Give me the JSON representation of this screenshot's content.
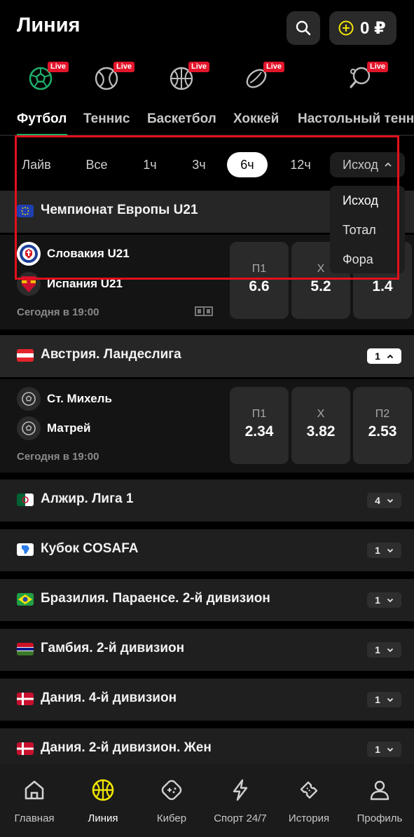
{
  "header": {
    "title": "Линия",
    "balance": "0 ₽"
  },
  "sports": [
    {
      "name": "Футбол",
      "live": "Live",
      "icon": "football-icon"
    },
    {
      "name": "Теннис",
      "live": "Live",
      "icon": "tennis-icon"
    },
    {
      "name": "Баскетбол",
      "live": "Live",
      "icon": "basketball-icon"
    },
    {
      "name": "Хоккей",
      "live": "Live",
      "icon": "hockey-icon"
    },
    {
      "name": "Настольный теннис",
      "live": "Live",
      "icon": "table-tennis-icon"
    }
  ],
  "filters": [
    "Лайв",
    "Все",
    "1ч",
    "3ч",
    "6ч",
    "12ч"
  ],
  "active_filter": "6ч",
  "outcome_select": {
    "value": "Исход",
    "options": [
      "Исход",
      "Тотал",
      "Фора"
    ]
  },
  "leagues": [
    {
      "name": "Чемпионат Европы U21",
      "flag": "eu"
    },
    {
      "name": "Австрия. Ландеслига",
      "count": "1"
    },
    {
      "name": "Алжир. Лига 1",
      "count": "4"
    },
    {
      "name": "Кубок COSAFA",
      "count": "1"
    },
    {
      "name": "Бразилия. Параенсе. 2-й дивизион",
      "count": "1"
    },
    {
      "name": "Гамбия. 2-й дивизион",
      "count": "1"
    },
    {
      "name": "Дания. 4-й дивизион",
      "count": "1"
    },
    {
      "name": "Дания. 2-й дивизион. Жен",
      "count": "1"
    }
  ],
  "matches": [
    {
      "team1": "Словакия U21",
      "team2": "Испания U21",
      "time": "Сегодня в 19:00",
      "odds": [
        {
          "label": "П1",
          "value": "6.6"
        },
        {
          "label": "Х",
          "value": "5.2"
        },
        {
          "label": "П2",
          "value": "1.4"
        }
      ]
    },
    {
      "team1": "Ст. Михель",
      "team2": "Матрей",
      "time": "Сегодня в 19:00",
      "odds": [
        {
          "label": "П1",
          "value": "2.34"
        },
        {
          "label": "Х",
          "value": "3.82"
        },
        {
          "label": "П2",
          "value": "2.53"
        }
      ]
    }
  ],
  "nav": [
    {
      "label": "Главная",
      "icon": "home-icon"
    },
    {
      "label": "Линия",
      "icon": "basketball-icon",
      "active": true
    },
    {
      "label": "Кибер",
      "icon": "gamepad-icon"
    },
    {
      "label": "Спорт 24/7",
      "icon": "lightning-icon"
    },
    {
      "label": "История",
      "icon": "ticket-icon"
    },
    {
      "label": "Профиль",
      "icon": "user-icon"
    }
  ],
  "colors": {
    "accent_green": "#1fae6b",
    "live_red": "#e3152b",
    "coin_yellow": "#f2e600",
    "highlight": "#e3101c"
  }
}
